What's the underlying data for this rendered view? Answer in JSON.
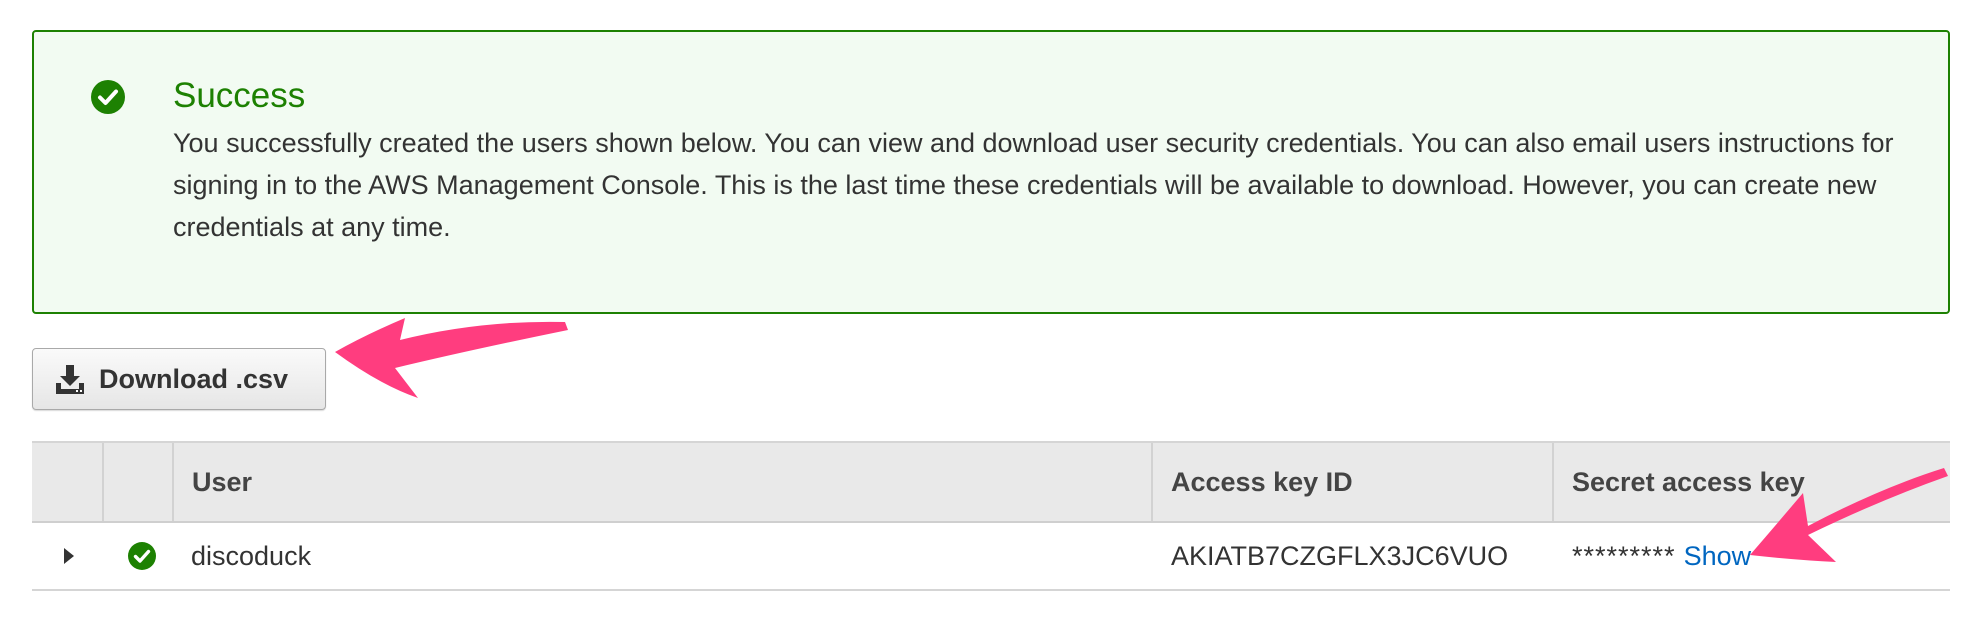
{
  "alert": {
    "icon": "check-circle-icon",
    "title": "Success",
    "message": "You successfully created the users shown below. You can view and download user security credentials. You can also email users instructions for signing in to the AWS Management Console. This is the last time these credentials will be available to download. However, you can create new credentials at any time.",
    "accent_color": "#1d8102"
  },
  "download_button": {
    "icon": "download-icon",
    "label": "Download .csv"
  },
  "table": {
    "columns": [
      "",
      "",
      "User",
      "Access key ID",
      "Secret access key"
    ],
    "rows": [
      {
        "user": "discoduck",
        "access_key_id": "AKIATB7CZGFLX3JC6VUO",
        "secret_masked": "*********",
        "show_label": "Show"
      }
    ]
  },
  "annotations": {
    "arrow_color": "#ff3d7f"
  }
}
